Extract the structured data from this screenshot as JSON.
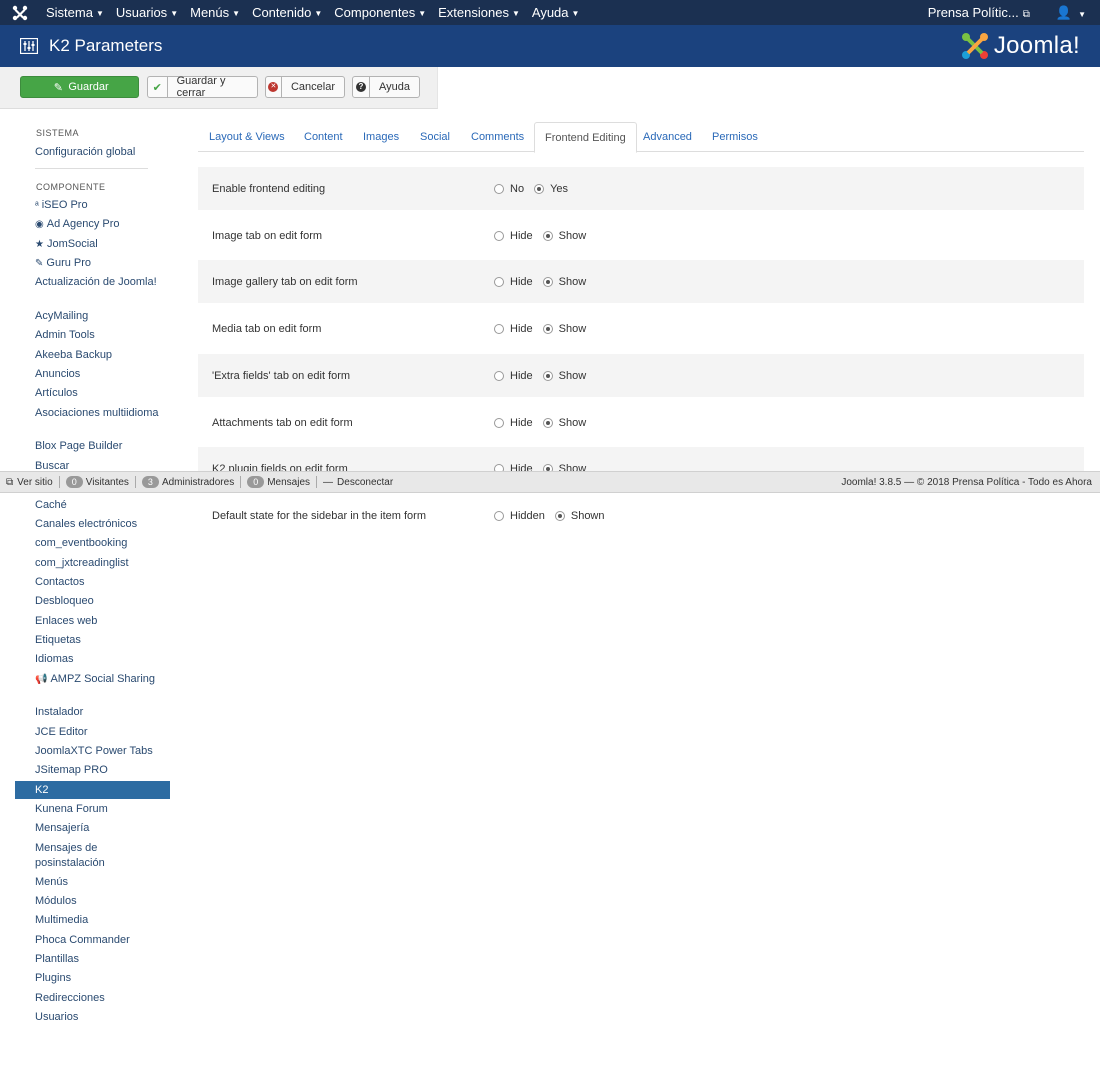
{
  "navbar": {
    "menu": [
      {
        "label": "Sistema"
      },
      {
        "label": "Usuarios"
      },
      {
        "label": "Menús"
      },
      {
        "label": "Contenido"
      },
      {
        "label": "Componentes"
      },
      {
        "label": "Extensiones"
      },
      {
        "label": "Ayuda"
      }
    ],
    "site_name": "Prensa Polític...",
    "user_icon": "user-icon"
  },
  "header": {
    "title": "K2 Parameters",
    "brand": "Joomla!"
  },
  "toolbar": {
    "save": "Guardar",
    "save_close": "Guardar y cerrar",
    "cancel": "Cancelar",
    "help": "Ayuda"
  },
  "sidebar": {
    "head_sistema": "SISTEMA",
    "global_config": "Configuración global",
    "head_componente": "COMPONENTE",
    "items": [
      {
        "label": "iSEO Pro",
        "icon": "iseo-icon"
      },
      {
        "label": "Ad Agency Pro",
        "icon": "adagency-icon"
      },
      {
        "label": "JomSocial",
        "icon": "star-icon"
      },
      {
        "label": "Guru Pro",
        "icon": "pencil-icon"
      },
      {
        "label": "Actualización de Joomla!"
      },
      {
        "label": "AcyMailing"
      },
      {
        "label": "Admin Tools"
      },
      {
        "label": "Akeeba Backup"
      },
      {
        "label": "Anuncios"
      },
      {
        "label": "Artículos"
      },
      {
        "label": "Asociaciones multiidioma"
      },
      {
        "label": "Blox Page Builder"
      },
      {
        "label": "Buscar"
      },
      {
        "label": "Caché"
      },
      {
        "label": "Canales electrónicos"
      },
      {
        "label": "com_eventbooking"
      },
      {
        "label": "com_jxtcreadinglist"
      },
      {
        "label": "Contactos"
      },
      {
        "label": "Desbloqueo"
      },
      {
        "label": "Enlaces web"
      },
      {
        "label": "Etiquetas"
      },
      {
        "label": "Idiomas"
      },
      {
        "label": "AMPZ Social Sharing",
        "icon": "ampz-icon"
      },
      {
        "label": "Instalador"
      },
      {
        "label": "JCE Editor"
      },
      {
        "label": "JoomlaXTC Power Tabs"
      },
      {
        "label": "JSitemap PRO"
      },
      {
        "label": "K2"
      },
      {
        "label": "Kunena Forum"
      },
      {
        "label": "Mensajería"
      },
      {
        "label": "Mensajes de posinstalación"
      },
      {
        "label": "Menús"
      },
      {
        "label": "Módulos"
      },
      {
        "label": "Multimedia"
      },
      {
        "label": "Phoca Commander"
      },
      {
        "label": "Plantillas"
      },
      {
        "label": "Plugins"
      },
      {
        "label": "Redirecciones"
      },
      {
        "label": "Usuarios"
      }
    ]
  },
  "tabs": [
    {
      "label": "Layout & Views"
    },
    {
      "label": "Content"
    },
    {
      "label": "Images"
    },
    {
      "label": "Social"
    },
    {
      "label": "Comments"
    },
    {
      "label": "Frontend Editing",
      "active": true
    },
    {
      "label": "Advanced"
    },
    {
      "label": "Permisos"
    }
  ],
  "form": {
    "rows": [
      {
        "label": "Enable frontend editing",
        "options": [
          "No",
          "Yes"
        ],
        "selected": "Yes"
      },
      {
        "label": "Image tab on edit form",
        "options": [
          "Hide",
          "Show"
        ],
        "selected": "Show"
      },
      {
        "label": "Image gallery tab on edit form",
        "options": [
          "Hide",
          "Show"
        ],
        "selected": "Show"
      },
      {
        "label": "Media tab on edit form",
        "options": [
          "Hide",
          "Show"
        ],
        "selected": "Show"
      },
      {
        "label": "'Extra fields' tab on edit form",
        "options": [
          "Hide",
          "Show"
        ],
        "selected": "Show"
      },
      {
        "label": "Attachments tab on edit form",
        "options": [
          "Hide",
          "Show"
        ],
        "selected": "Show"
      },
      {
        "label": "K2 plugin fields on edit form",
        "options": [
          "Hide",
          "Show"
        ],
        "selected": "Show"
      },
      {
        "label": "Default state for the sidebar in the item form",
        "options": [
          "Hidden",
          "Shown"
        ],
        "selected": "Shown"
      }
    ]
  },
  "statusbar": {
    "view_site": "Ver sitio",
    "visitors_count": "0",
    "visitors": "Visitantes",
    "admins_count": "3",
    "admins": "Administradores",
    "messages_count": "0",
    "messages": "Mensajes",
    "logout": "Desconectar",
    "footer": "Joomla! 3.8.5  —  © 2018 Prensa Política - Todo es Ahora"
  }
}
